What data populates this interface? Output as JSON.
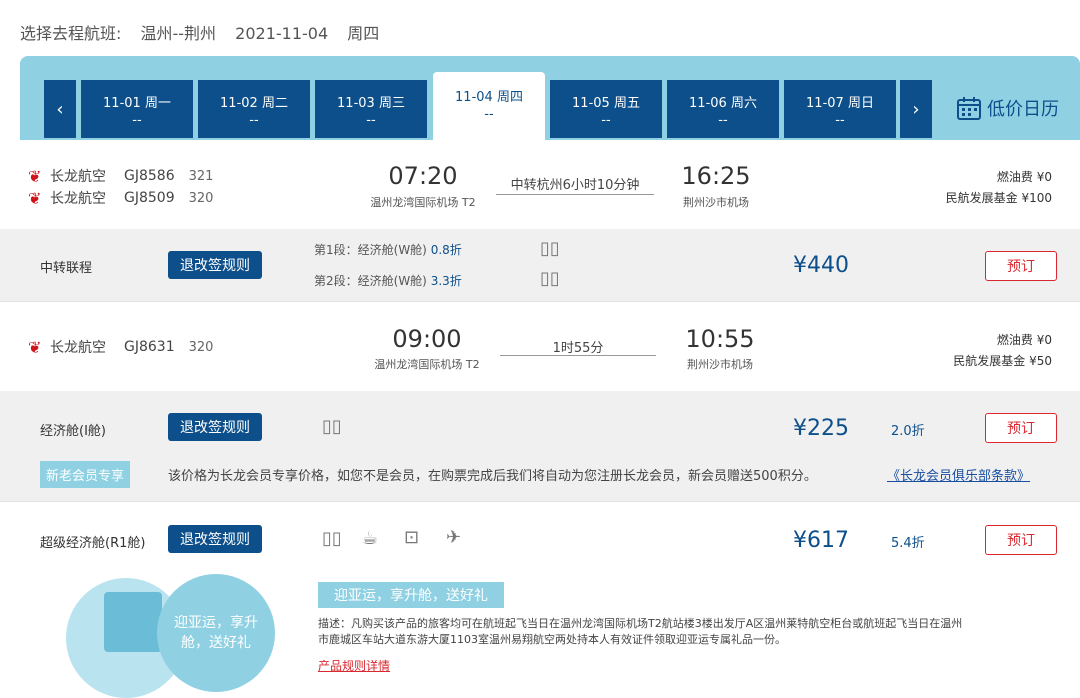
{
  "header": {
    "label": "选择去程航班:",
    "route": "温州--荆州",
    "date": "2021-11-04",
    "weekday": "周四"
  },
  "datebar": {
    "prev_icon": "‹",
    "next_icon": "›",
    "tabs": [
      {
        "date": "11-01 周一",
        "price": "--"
      },
      {
        "date": "11-02 周二",
        "price": "--"
      },
      {
        "date": "11-03 周三",
        "price": "--"
      },
      {
        "date": "11-04 周四",
        "price": "--"
      },
      {
        "date": "11-05 周五",
        "price": "--"
      },
      {
        "date": "11-06 周六",
        "price": "--"
      },
      {
        "date": "11-07 周日",
        "price": "--"
      }
    ],
    "low_price_calendar": "低价日历"
  },
  "flight1": {
    "legs": [
      {
        "airline": "长龙航空",
        "code": "GJ8586",
        "plane": "321"
      },
      {
        "airline": "长龙航空",
        "code": "GJ8509",
        "plane": "320"
      }
    ],
    "dep_time": "07:20",
    "dep_airport": "温州龙湾国际机场 T2",
    "route_info": "中转杭州6小时10分钟",
    "arr_time": "16:25",
    "arr_airport": "荆州沙市机场",
    "fuel_label": "燃油费",
    "fuel_value": "¥0",
    "fund_label": "民航发展基金",
    "fund_value": "¥100",
    "fare": {
      "name": "中转联程",
      "rule_button": "退改签规则",
      "seg1": "第1段：经济舱(W舱)",
      "seg1_disc": "0.8折",
      "seg2": "第2段：经济舱(W舱)",
      "seg2_disc": "3.3折",
      "price": "¥440",
      "book": "预订"
    }
  },
  "flight2": {
    "airline": "长龙航空",
    "code": "GJ8631",
    "plane": "320",
    "dep_time": "09:00",
    "dep_airport": "温州龙湾国际机场 T2",
    "route_info": "1时55分",
    "arr_time": "10:55",
    "arr_airport": "荆州沙市机场",
    "fuel_label": "燃油费",
    "fuel_value": "¥0",
    "fund_label": "民航发展基金",
    "fund_value": "¥50",
    "fare1": {
      "name": "经济舱(I舱)",
      "rule_button": "退改签规则",
      "price": "¥225",
      "disc": "2.0折",
      "book": "预订",
      "member_tag": "新老会员专享",
      "member_text": "该价格为长龙会员专享价格，如您不是会员，在购票完成后我们将自动为您注册长龙会员，新会员赠送500积分。",
      "member_link": "《长龙会员俱乐部条款》"
    },
    "fare2": {
      "name": "超级经济舱(R1舱)",
      "rule_button": "退改签规则",
      "price": "¥617",
      "disc": "5.4折",
      "book": "预订",
      "promo": "迎亚运，享升舱，送好礼",
      "promo_image_text": "迎亚运，享升舱，送好礼",
      "desc": "描述：凡购买该产品的旅客均可在航班起飞当日在温州龙湾国际机场T2航站楼3楼出发厅A区温州莱特航空柜台或航班起飞当日在温州市鹿城区车站大道东游大厦1103室温州易翔航空两处持本人有效证件领取迎亚运专属礼品一份。",
      "rules_link": "产品规则详情"
    }
  },
  "icons": {
    "baggage": "luggage-icon",
    "meal": "meal-icon",
    "carryon": "carry-on-icon",
    "upgrade": "plane-icon",
    "airline_logo": "airline-logo-icon"
  }
}
